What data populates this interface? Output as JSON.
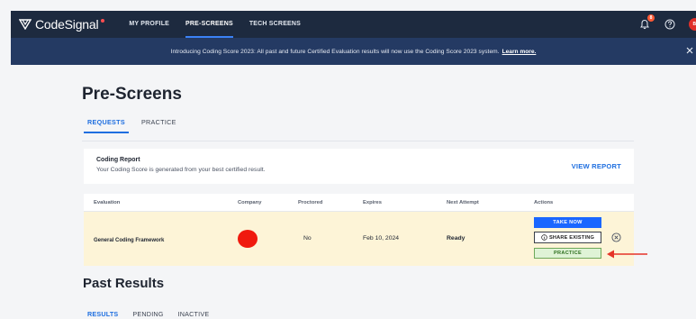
{
  "nav": {
    "brand": "CodeSignal",
    "links": [
      {
        "label": "MY PROFILE",
        "active": false
      },
      {
        "label": "PRE-SCREENS",
        "active": true
      },
      {
        "label": "TECH SCREENS",
        "active": false
      }
    ],
    "notifications_count": "8",
    "avatar_initials": "BI"
  },
  "announcement": {
    "text": "Introducing Coding Score 2023: All past and future Certified Evaluation results will now use the Coding Score 2023 system.",
    "link": "Learn more."
  },
  "page": {
    "title": "Pre-Screens",
    "tabs": [
      {
        "label": "REQUESTS",
        "active": true
      },
      {
        "label": "PRACTICE",
        "active": false
      }
    ]
  },
  "report": {
    "title": "Coding Report",
    "description": "Your Coding Score is generated from your best certified result.",
    "link": "VIEW REPORT"
  },
  "table": {
    "headers": [
      "Evaluation",
      "Company",
      "Proctored",
      "Expires",
      "Next Attempt",
      "Actions"
    ],
    "row": {
      "evaluation": "General Coding Framework",
      "proctored": "No",
      "expires": "Feb 10, 2024",
      "next_attempt": "Ready"
    },
    "actions": {
      "take_now": "TAKE NOW",
      "share_existing": "SHARE EXISTING",
      "practice": "PRACTICE"
    }
  },
  "past": {
    "title": "Past Results",
    "tabs": [
      {
        "label": "RESULTS",
        "active": true
      },
      {
        "label": "PENDING",
        "active": false
      },
      {
        "label": "INACTIVE",
        "active": false
      }
    ]
  },
  "colors": {
    "nav_bg": "#1d2a3f",
    "banner_bg": "#243a63",
    "accent": "#1f6fe0",
    "row_highlight": "#fdf4d7",
    "company_logo": "#f01a0e",
    "arrow": "#e53328"
  }
}
